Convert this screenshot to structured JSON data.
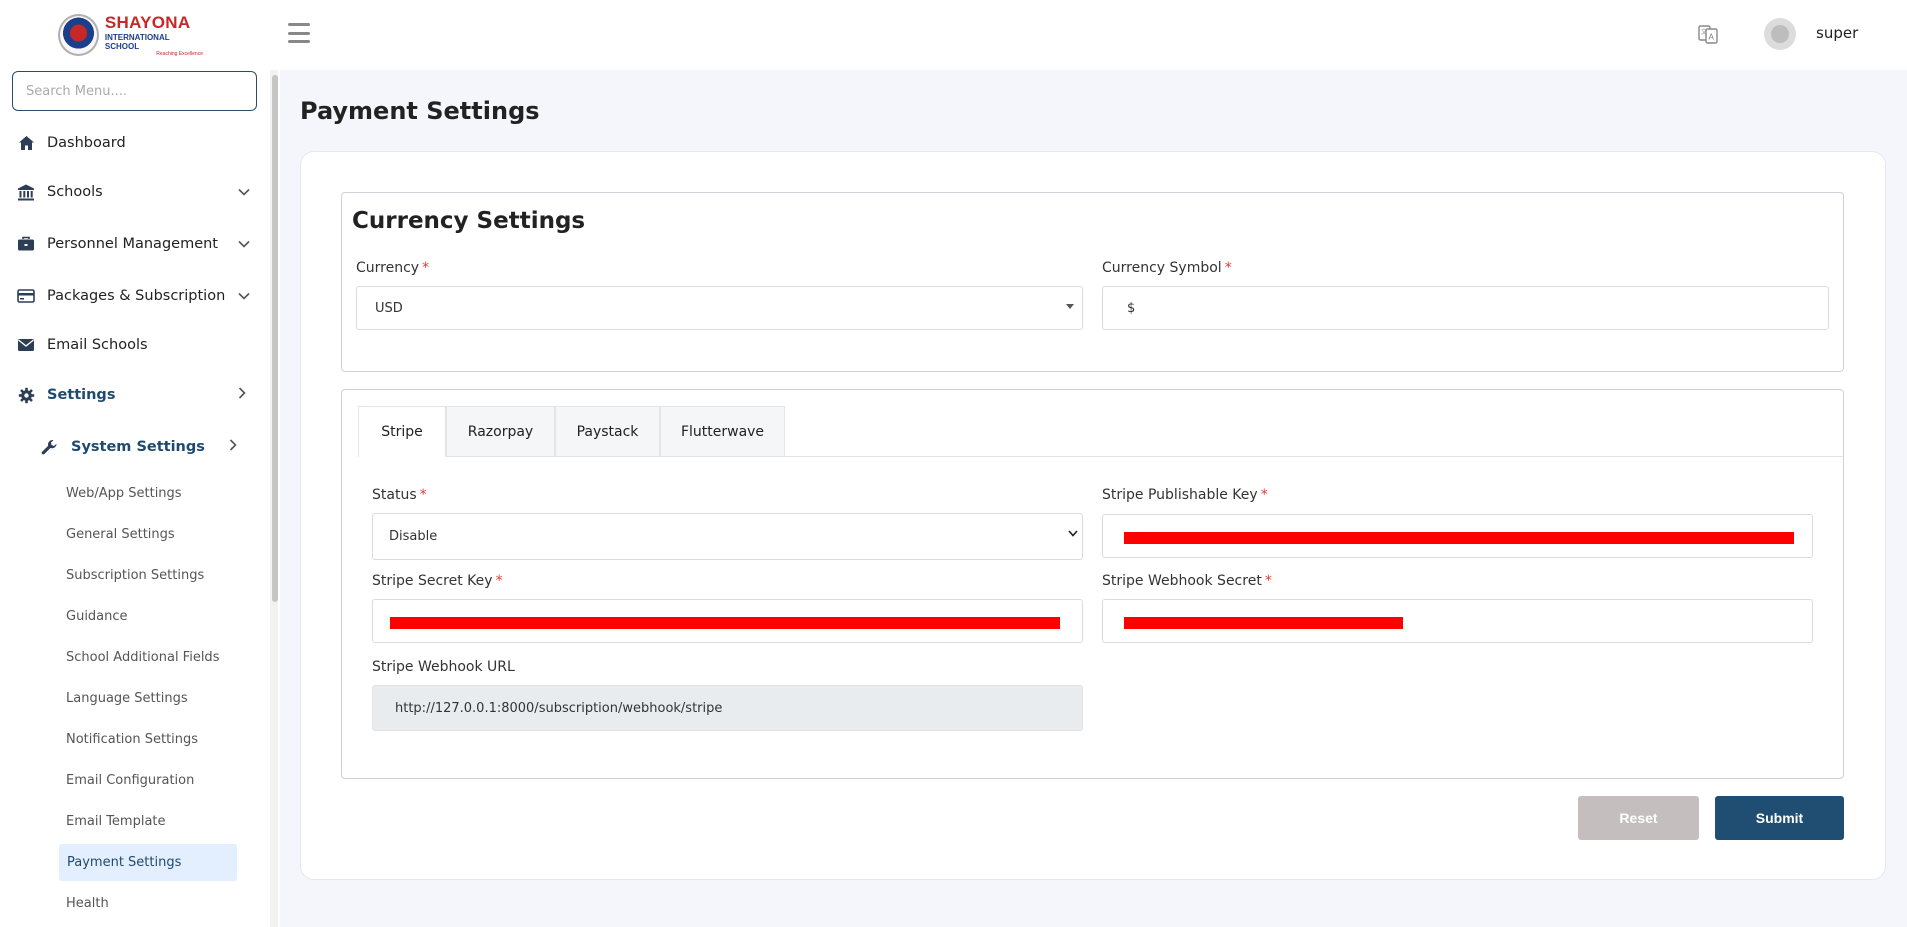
{
  "brand": {
    "name": "SHAYONA",
    "subtitle": "INTERNATIONAL SCHOOL",
    "tagline": "Reaching Excellence"
  },
  "sidebar": {
    "search_placeholder": "Search Menu....",
    "items": [
      {
        "label": "Dashboard",
        "icon": "home-icon"
      },
      {
        "label": "Schools",
        "icon": "bank-icon"
      },
      {
        "label": "Personnel Management",
        "icon": "briefcase-icon"
      },
      {
        "label": "Packages & Subscription",
        "icon": "credit-card-icon"
      },
      {
        "label": "Email Schools",
        "icon": "envelope-icon"
      },
      {
        "label": "Settings",
        "icon": "gear-icon"
      },
      {
        "label": "System Settings",
        "icon": "wrench-icon"
      }
    ],
    "sub_items": [
      "Web/App Settings",
      "General Settings",
      "Subscription Settings",
      "Guidance",
      "School Additional Fields",
      "Language Settings",
      "Notification Settings",
      "Email Configuration",
      "Email Template",
      "Payment Settings",
      "Health"
    ]
  },
  "header": {
    "username": "super"
  },
  "page": {
    "title": "Payment Settings"
  },
  "currency_settings": {
    "title": "Currency Settings",
    "currency_label": "Currency",
    "currency_value": "USD",
    "symbol_label": "Currency Symbol",
    "symbol_value": "$"
  },
  "tabs": [
    "Stripe",
    "Razorpay",
    "Paystack",
    "Flutterwave"
  ],
  "active_tab": "Stripe",
  "stripe": {
    "status_label": "Status",
    "status_value": "Disable",
    "publishable_key_label": "Stripe Publishable Key",
    "secret_key_label": "Stripe Secret Key",
    "webhook_secret_label": "Stripe Webhook Secret",
    "webhook_url_label": "Stripe Webhook URL",
    "webhook_url_value": "http://127.0.0.1:8000/subscription/webhook/stripe"
  },
  "buttons": {
    "reset": "Reset",
    "submit": "Submit"
  },
  "colors": {
    "primary": "#1f4e72",
    "required": "#e53935",
    "redaction": "#ff0000",
    "active_menu_bg": "#e3efff"
  }
}
